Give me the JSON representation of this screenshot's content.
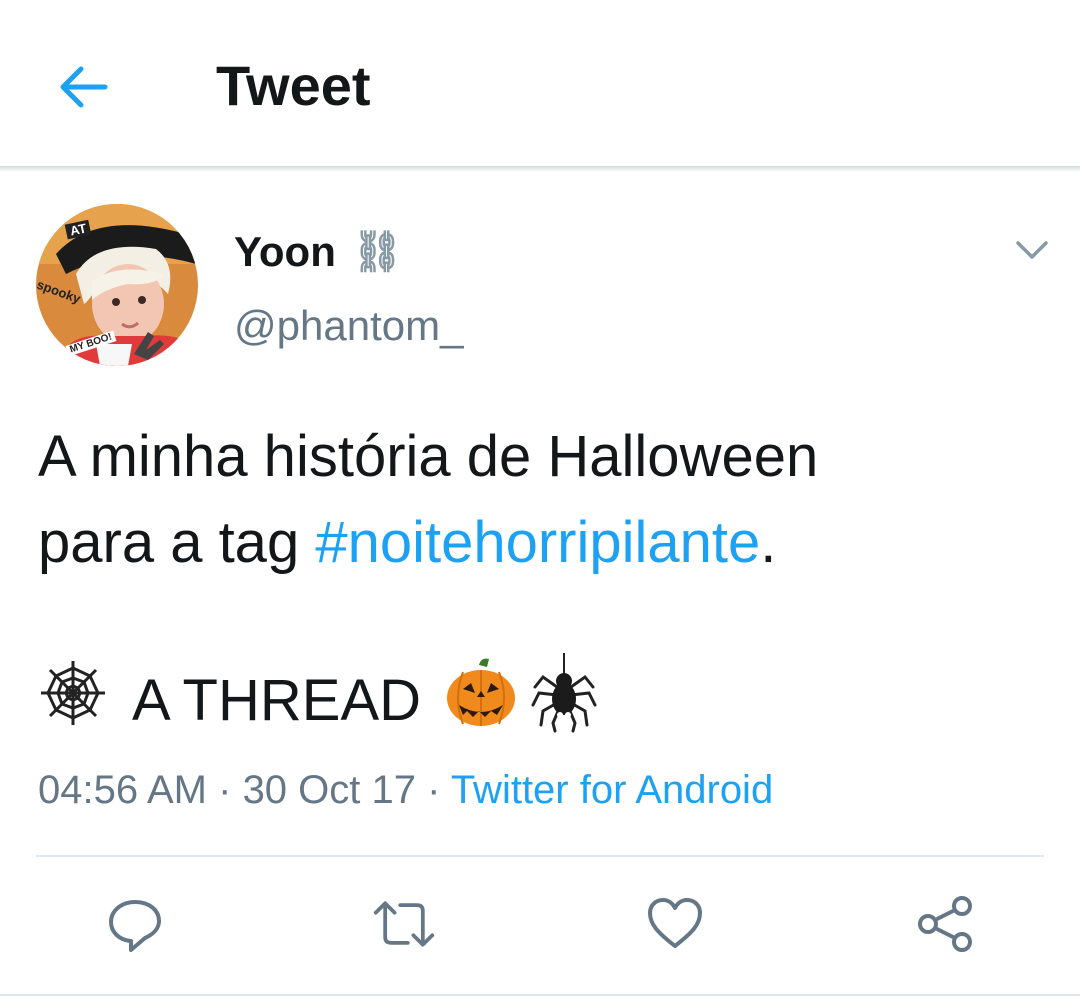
{
  "header": {
    "title": "Tweet",
    "back_icon": "arrow-left-icon"
  },
  "colors": {
    "accent": "#1da1f2",
    "text": "#14171a",
    "secondary": "#657786",
    "icon_gray": "#8899a6",
    "divider": "#e1e8ed"
  },
  "tweet": {
    "author": {
      "display_name": "Yoon",
      "name_badge": "⛓",
      "handle": "@phantom_",
      "avatar_stickers": [
        "AT",
        "spooky",
        "MY BOO!"
      ]
    },
    "text_line1": "A minha história de Halloween",
    "text_prefix": "para a tag ",
    "hashtag": "#noitehorripilante",
    "text_suffix": ".",
    "thread_web_emoji": "🕸",
    "thread_text": "A THREAD",
    "thread_pumpkin_emoji": "🎃",
    "thread_spider_emoji": "🕷",
    "time": "04:56 AM",
    "separator": " · ",
    "date": "30 Oct 17",
    "source": "Twitter for Android"
  },
  "actions": {
    "reply_icon": "reply-icon",
    "retweet_icon": "retweet-icon",
    "like_icon": "heart-icon",
    "share_icon": "share-icon"
  }
}
